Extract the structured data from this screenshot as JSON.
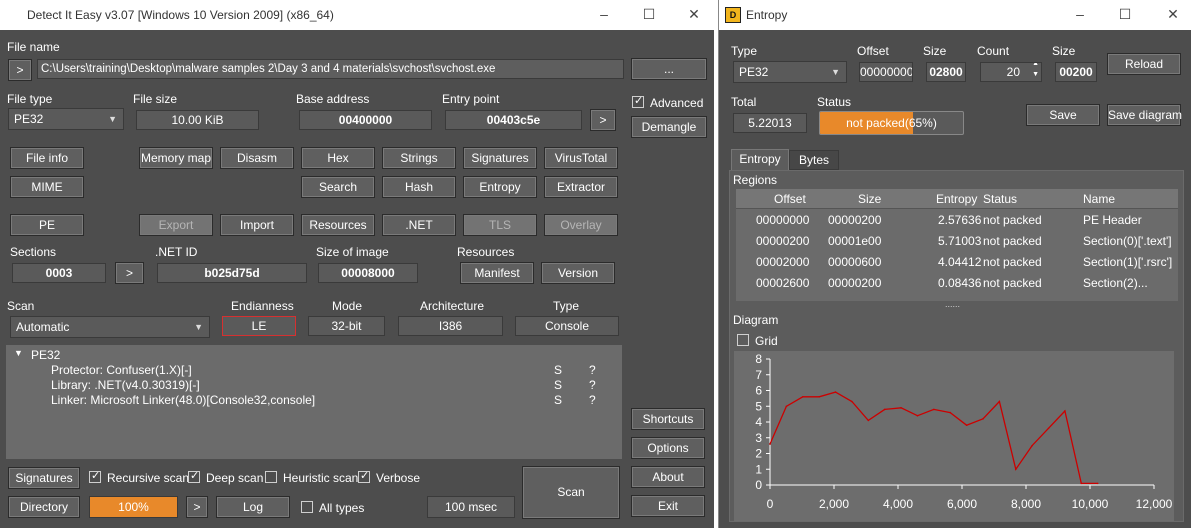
{
  "main": {
    "title": "Detect It Easy v3.07 [Windows 10 Version 2009] (x86_64)",
    "file_name_label": "File name",
    "file_path": "C:\\Users\\training\\Desktop\\malware samples 2\\Day 3 and 4 materials\\svchost\\svchost.exe",
    "browse_label": "...",
    "open_arrow": ">",
    "file_type_label": "File type",
    "file_type_value": "PE32",
    "file_size_label": "File size",
    "file_size_value": "10.00 KiB",
    "base_address_label": "Base address",
    "base_address_value": "00400000",
    "entry_point_label": "Entry point",
    "entry_point_value": "00403c5e",
    "entry_arrow": ">",
    "advanced_label": "Advanced",
    "demangle_label": "Demangle",
    "buttons_row1": [
      "File info",
      "Memory map",
      "Disasm",
      "Hex",
      "Strings",
      "Signatures",
      "VirusTotal"
    ],
    "buttons_row2": [
      "MIME",
      "Search",
      "Hash",
      "Entropy",
      "Extractor"
    ],
    "buttons_row3": [
      "PE",
      "Export",
      "Import",
      "Resources",
      ".NET",
      "TLS",
      "Overlay"
    ],
    "sections_label": "Sections",
    "sections_value": "0003",
    "sections_arrow": ">",
    "net_id_label": ".NET ID",
    "net_id_value": "b025d75d",
    "size_of_image_label": "Size of image",
    "size_of_image_value": "00008000",
    "resources_label": "Resources",
    "manifest_label": "Manifest",
    "version_label": "Version",
    "scan_label": "Scan",
    "scan_mode_value": "Automatic",
    "endianness_label": "Endianness",
    "endianness_value": "LE",
    "mode_label": "Mode",
    "mode_value": "32-bit",
    "architecture_label": "Architecture",
    "architecture_value": "I386",
    "type_label": "Type",
    "type_value": "Console",
    "tree_root": "PE32",
    "detections": [
      {
        "text": "Protector: Confuser(1.X)[-]",
        "s": "S",
        "q": "?"
      },
      {
        "text": "Library: .NET(v4.0.30319)[-]",
        "s": "S",
        "q": "?"
      },
      {
        "text": "Linker: Microsoft Linker(48.0)[Console32,console]",
        "s": "S",
        "q": "?"
      }
    ],
    "shortcuts_label": "Shortcuts",
    "options_label": "Options",
    "about_label": "About",
    "exit_label": "Exit",
    "signatures_label": "Signatures",
    "recursive_scan_label": "Recursive scan",
    "deep_scan_label": "Deep scan",
    "heuristic_scan_label": "Heuristic scan",
    "verbose_label": "Verbose",
    "scan_button_label": "Scan",
    "directory_label": "Directory",
    "progress_value": "100%",
    "progress_arrow": ">",
    "log_label": "Log",
    "all_types_label": "All types",
    "time_value": "100 msec"
  },
  "entropy": {
    "title": "Entropy",
    "type_label": "Type",
    "type_value": "PE32",
    "offset_label": "Offset",
    "offset_value": "00000000",
    "size_label": "Size",
    "size_value": "02800",
    "count_label": "Count",
    "count_value": "20",
    "size2_label": "Size",
    "size2_value": "00200",
    "reload_label": "Reload",
    "total_label": "Total",
    "total_value": "5.22013",
    "status_label": "Status",
    "status_value": "not packed(65%)",
    "status_progress": 0.65,
    "save_label": "Save",
    "save_diagram_label": "Save diagram",
    "tabs": [
      "Entropy",
      "Bytes"
    ],
    "regions_label": "Regions",
    "columns": [
      "Offset",
      "Size",
      "Entropy",
      "Status",
      "Name"
    ],
    "regions": [
      [
        "00000000",
        "00000200",
        "2.57636",
        "not packed",
        "PE Header"
      ],
      [
        "00000200",
        "00001e00",
        "5.71003",
        "not packed",
        "Section(0)['.text']"
      ],
      [
        "00002000",
        "00000600",
        "4.04412",
        "not packed",
        "Section(1)['.rsrc']"
      ],
      [
        "00002600",
        "00000200",
        "0.08436",
        "not packed",
        "Section(2)..."
      ]
    ],
    "splitter": "......",
    "diagram_label": "Diagram",
    "grid_label": "Grid"
  },
  "chart_data": {
    "type": "line",
    "title": "",
    "xlabel": "",
    "ylabel": "",
    "xlim": [
      0,
      12000
    ],
    "ylim": [
      0,
      8
    ],
    "x_ticks": [
      "0",
      "2,000",
      "4,000",
      "6,000",
      "8,000",
      "10,000",
      "12,000"
    ],
    "y_ticks": [
      "0",
      "1",
      "2",
      "3",
      "4",
      "5",
      "6",
      "7",
      "8"
    ],
    "grid": false,
    "color": "#cc0000",
    "series": [
      {
        "x": [
          0,
          512,
          1024,
          1536,
          2048,
          2560,
          3072,
          3584,
          4096,
          4608,
          5120,
          5632,
          6144,
          6656,
          7168,
          7680,
          8192,
          8704,
          9216,
          9728,
          10240
        ],
        "y": [
          2.6,
          5.0,
          5.6,
          5.6,
          5.9,
          5.3,
          4.1,
          4.8,
          4.9,
          4.4,
          4.8,
          4.6,
          3.8,
          4.2,
          5.3,
          1.0,
          2.5,
          3.6,
          4.7,
          0.1,
          0.1
        ]
      }
    ]
  }
}
